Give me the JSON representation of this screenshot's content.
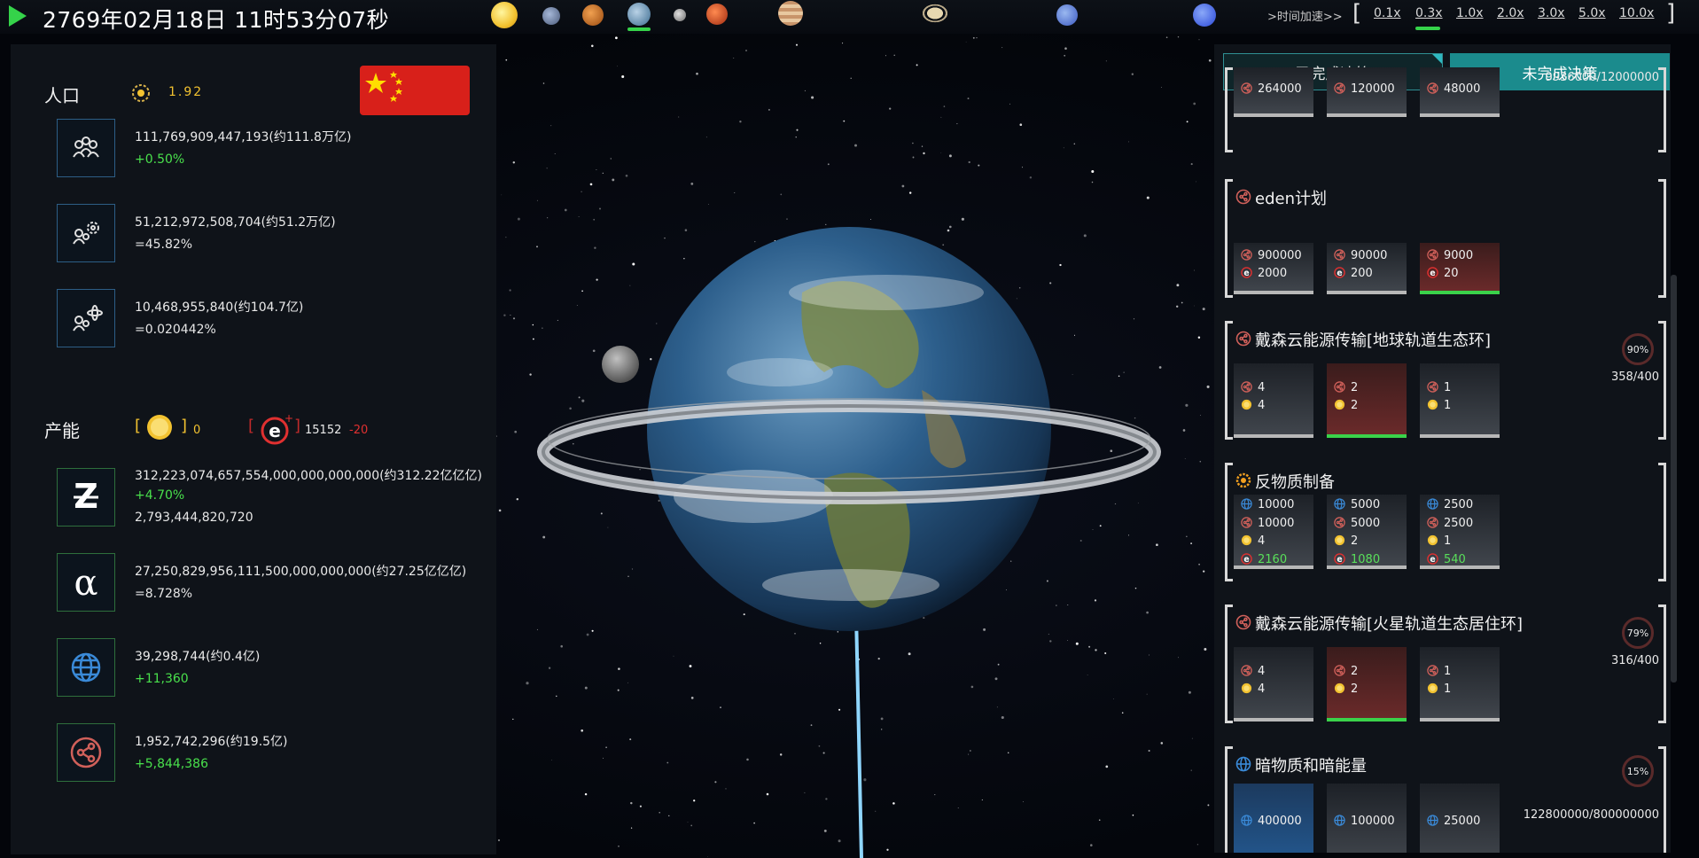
{
  "topbar": {
    "datetime": "2769年02月18日 11时53分07秒",
    "planets": [
      "sun-icon",
      "mercury-icon",
      "venus-icon",
      "earth-icon",
      "moon-icon",
      "mars-icon",
      "jupiter-icon",
      "saturn-icon",
      "uranus-icon",
      "neptune-icon"
    ],
    "selected_planet": "earth-icon",
    "speed_label": ">时间加速>>",
    "bracket_open": "[",
    "bracket_close": "]",
    "speeds": [
      "0.1x",
      "0.3x",
      "1.0x",
      "2.0x",
      "3.0x",
      "5.0x",
      "10.0x"
    ],
    "selected_speed": "0.3x"
  },
  "left": {
    "population": {
      "title": "人口",
      "rate": "1.92",
      "rows": [
        {
          "icon": "population-icon",
          "main": "111,769,909,447,193(约111.8万亿)",
          "sub": "+0.50%",
          "sub_type": "pos"
        },
        {
          "icon": "engineer-population-icon",
          "main": "51,212,972,508,704(约51.2万亿)",
          "sub": "=45.82%",
          "sub_type": "neu"
        },
        {
          "icon": "scientist-population-icon",
          "main": "10,468,955,840(约104.7亿)",
          "sub": "=0.020442%",
          "sub_type": "neu"
        }
      ]
    },
    "production": {
      "title": "产能",
      "sun_open": "[",
      "sun_close": "]",
      "sun_value": "0",
      "e_open": "[",
      "e_close": "]",
      "e_value": "15152",
      "e_delta": "-20",
      "rows": [
        {
          "icon": "z-resource-icon",
          "main": "312,223,074,657,554,000,000,000,000(约312.22亿亿亿)",
          "sub": "+4.70%",
          "sub_type": "pos",
          "extra": "2,793,444,820,720"
        },
        {
          "icon": "alpha-resource-icon",
          "main": "27,250,829,956,111,500,000,000,000(约27.25亿亿亿)",
          "sub": "=8.728%",
          "sub_type": "neu"
        },
        {
          "icon": "globe-icon",
          "main": "39,298,744(约0.4亿)",
          "sub": "+11,360",
          "sub_type": "pos"
        },
        {
          "icon": "share-network-icon",
          "main": "1,952,742,296(约19.5亿)",
          "sub": "+5,844,386",
          "sub_type": "pos"
        }
      ]
    }
  },
  "right": {
    "tabs": {
      "done": "已完成决策",
      "todo": "未完成决策"
    },
    "cards": [
      {
        "title": "",
        "progress": "9936000/12000000",
        "options": [
          {
            "lines": [
              {
                "icon": "share-icon",
                "value": "264000"
              }
            ]
          },
          {
            "lines": [
              {
                "icon": "share-icon",
                "value": "120000"
              }
            ]
          },
          {
            "lines": [
              {
                "icon": "share-icon",
                "value": "48000"
              }
            ]
          }
        ]
      },
      {
        "title": "eden计划",
        "options": [
          {
            "lines": [
              {
                "icon": "share-icon",
                "value": "900000"
              },
              {
                "icon": "e-icon",
                "value": "2000"
              }
            ]
          },
          {
            "lines": [
              {
                "icon": "share-icon",
                "value": "90000"
              },
              {
                "icon": "e-icon",
                "value": "200"
              }
            ]
          },
          {
            "lines": [
              {
                "icon": "share-icon",
                "value": "9000"
              },
              {
                "icon": "e-icon",
                "value": "20"
              }
            ],
            "selected": true
          }
        ]
      },
      {
        "title": "戴森云能源传输[地球轨道生态环]",
        "ring": "90%",
        "progress": "358/400",
        "options": [
          {
            "lines": [
              {
                "icon": "share-icon",
                "value": "4"
              },
              {
                "icon": "sun-icon",
                "value": "4"
              }
            ]
          },
          {
            "lines": [
              {
                "icon": "share-icon",
                "value": "2"
              },
              {
                "icon": "sun-icon",
                "value": "2"
              }
            ],
            "selected": true
          },
          {
            "lines": [
              {
                "icon": "share-icon",
                "value": "1"
              },
              {
                "icon": "sun-icon",
                "value": "1"
              }
            ]
          }
        ]
      },
      {
        "title": "反物质制备",
        "options": [
          {
            "lines": [
              {
                "icon": "globe-icon",
                "value": "10000"
              },
              {
                "icon": "share-icon",
                "value": "10000"
              },
              {
                "icon": "sun-icon",
                "value": "4"
              },
              {
                "icon": "e-icon",
                "value": "2160",
                "green": true
              }
            ]
          },
          {
            "lines": [
              {
                "icon": "globe-icon",
                "value": "5000"
              },
              {
                "icon": "share-icon",
                "value": "5000"
              },
              {
                "icon": "sun-icon",
                "value": "2"
              },
              {
                "icon": "e-icon",
                "value": "1080",
                "green": true
              }
            ]
          },
          {
            "lines": [
              {
                "icon": "globe-icon",
                "value": "2500"
              },
              {
                "icon": "share-icon",
                "value": "2500"
              },
              {
                "icon": "sun-icon",
                "value": "1"
              },
              {
                "icon": "e-icon",
                "value": "540",
                "green": true
              }
            ]
          }
        ]
      },
      {
        "title": "戴森云能源传输[火星轨道生态居住环]",
        "ring": "79%",
        "progress": "316/400",
        "options": [
          {
            "lines": [
              {
                "icon": "share-icon",
                "value": "4"
              },
              {
                "icon": "sun-icon",
                "value": "4"
              }
            ]
          },
          {
            "lines": [
              {
                "icon": "share-icon",
                "value": "2"
              },
              {
                "icon": "sun-icon",
                "value": "2"
              }
            ],
            "selected": true
          },
          {
            "lines": [
              {
                "icon": "share-icon",
                "value": "1"
              },
              {
                "icon": "sun-icon",
                "value": "1"
              }
            ]
          }
        ]
      },
      {
        "title": "暗物质和暗能量",
        "ring": "15%",
        "progress": "122800000/800000000",
        "options": [
          {
            "lines": [
              {
                "icon": "globe-icon",
                "value": "400000"
              }
            ],
            "blue": true
          },
          {
            "lines": [
              {
                "icon": "globe-icon",
                "value": "100000"
              }
            ]
          },
          {
            "lines": [
              {
                "icon": "globe-icon",
                "value": "25000"
              }
            ]
          }
        ]
      }
    ]
  },
  "colors": {
    "accent": "#1b8b8d",
    "positive": "#49e04c",
    "negative": "#e03030",
    "gold": "#f2c230"
  }
}
